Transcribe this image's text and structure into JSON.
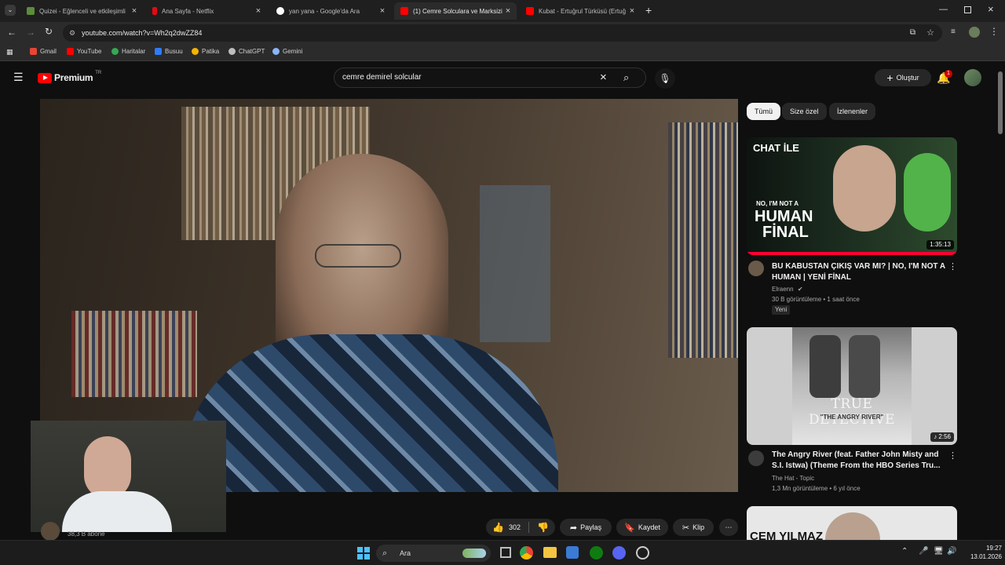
{
  "browser": {
    "tabs": [
      {
        "title": "Quizei - Eğlenceli ve etkileşimli",
        "active": false
      },
      {
        "title": "Ana Sayfa - Netflix",
        "active": false
      },
      {
        "title": "yan yana - Google'da Ara",
        "active": false
      },
      {
        "title": "(1) Cemre Solculara ve Marksizi",
        "active": true
      },
      {
        "title": "Kubat - Ertuğrul Türküsü (Ertuğ",
        "active": false
      }
    ],
    "url": "youtube.com/watch?v=Wh2q2dwZZ84",
    "bookmarks": [
      "Gmail",
      "YouTube",
      "Haritalar",
      "Busuu",
      "Patika",
      "ChatGPT",
      "Gemini"
    ]
  },
  "youtube": {
    "logo_text": "Premium",
    "logo_region": "TR",
    "search_value": "cemre demirel solcular",
    "create_label": "Oluştur",
    "notification_count": "1",
    "chips": [
      "Tümü",
      "Size özel",
      "İzlenenler"
    ],
    "actions": {
      "like_count": "302",
      "share": "Paylaş",
      "save": "Kaydet",
      "clip": "Klip"
    },
    "channel_subscribers": "38,3 B abone",
    "recommendations": [
      {
        "duration": "1:35:13",
        "title_line1": "BU KABUSTAN ÇIKIŞ VAR MI? | NO, I'M NOT A",
        "title_line2": "HUMAN | YENİ FİNAL",
        "channel": "Elraenn",
        "meta": "30 B görüntüleme • 1 saat önce",
        "badge": "Yeni",
        "thumb_text1": "CHAT İLE",
        "thumb_text2": "NO, I'M NOT A",
        "thumb_text3": "HUMAN",
        "thumb_text4": "FİNAL"
      },
      {
        "duration": "2:56",
        "title_line1": "The Angry River (feat. Father John Misty and",
        "title_line2": "S.I. Istwa) (Theme From the HBO Series Tru...",
        "channel": "The Hat - Topic",
        "meta": "1,3 Mn görüntüleme • 6 yıl önce",
        "thumb_text1": "TRUE DETECTIVE",
        "thumb_text2": "\"THE ANGRY RIVER\""
      },
      {
        "thumb_text1": "CEM YILMAZ"
      }
    ]
  },
  "taskbar": {
    "search_label": "Ara",
    "time": "19:27",
    "date": "13.01.2026"
  },
  "colors": {
    "yt_red": "#ff0000",
    "chrome_bg": "#2b2b2b",
    "page_bg": "#0f0f0f"
  }
}
